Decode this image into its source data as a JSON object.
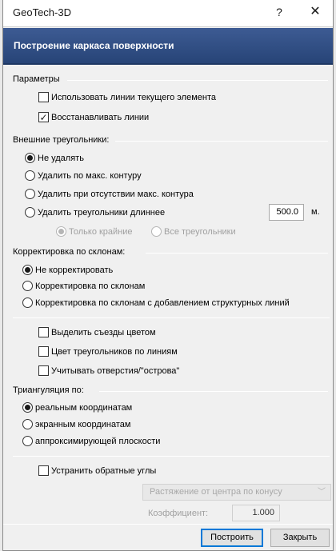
{
  "window": {
    "title": "GeoTech-3D",
    "help": "?",
    "close": "✕"
  },
  "header": {
    "title": "Построение каркаса поверхности"
  },
  "params": {
    "label": "Параметры",
    "use_lines": {
      "label": "Использовать линии текущего элемента",
      "checked": false
    },
    "restore_lines": {
      "label": "Восстанавливать линии",
      "checked": true
    }
  },
  "outer": {
    "label": "Внешние треугольники:",
    "options": [
      {
        "label": "Не удалять",
        "selected": true
      },
      {
        "label": "Удалить по макс. контуру",
        "selected": false
      },
      {
        "label": "Удалить при отсутствии макс. контура",
        "selected": false
      },
      {
        "label": "Удалить треугольники длиннее",
        "selected": false
      }
    ],
    "length_value": "500.0",
    "length_unit": "м.",
    "sub_options": [
      {
        "label": "Только крайние",
        "selected": true
      },
      {
        "label": "Все треугольники",
        "selected": false
      }
    ]
  },
  "slope": {
    "label": "Корректировка по склонам:",
    "options": [
      {
        "label": "Не корректировать",
        "selected": true
      },
      {
        "label": "Корректировка по склонам",
        "selected": false
      },
      {
        "label": "Корректировка по склонам с добавлением структурных линий",
        "selected": false
      }
    ]
  },
  "checks": {
    "highlight_exits": {
      "label": "Выделить съезды цветом",
      "checked": false
    },
    "triangle_color": {
      "label": "Цвет треугольников по линиям",
      "checked": false
    },
    "consider_holes": {
      "label": "Учитывать отверстия/\"острова\"",
      "checked": false
    }
  },
  "triangulation": {
    "label": "Триангуляция по:",
    "options": [
      {
        "label": "реальным координатам",
        "selected": true
      },
      {
        "label": "экранным координатам",
        "selected": false
      },
      {
        "label": "аппроксимирующей плоскости",
        "selected": false
      }
    ]
  },
  "reverse": {
    "label": "Устранить обратные углы",
    "checked": false,
    "method": "Растяжение от центра по конусу",
    "coef_label": "Коэффициент:",
    "coef_value": "1.000"
  },
  "buttons": {
    "build": "Построить",
    "close": "Закрыть"
  },
  "colors": {
    "header_bg": "#2f4f85",
    "header_text": "#ffffff",
    "focus_border": "#0078d7"
  }
}
